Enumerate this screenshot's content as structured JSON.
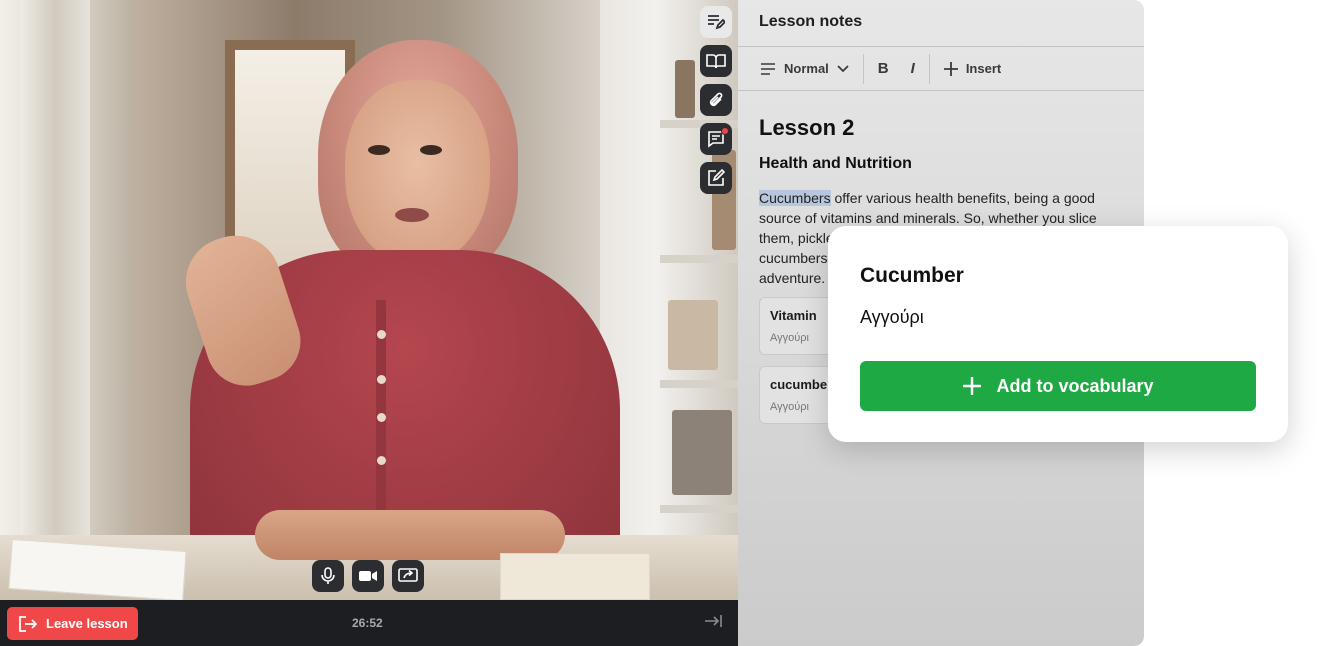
{
  "video": {
    "timer": "26:52",
    "leave_label": "Leave lesson"
  },
  "rail": {
    "icons": [
      "notes-icon",
      "book-icon",
      "paperclip-icon",
      "chat-icon",
      "edit-icon"
    ]
  },
  "notes": {
    "title": "Lesson notes",
    "toolbar": {
      "style_label": "Normal",
      "bold_label": "B",
      "italic_label": "I",
      "insert_label": "Insert"
    },
    "heading": "Lesson 2",
    "subheading": "Health and Nutrition",
    "highlighted_word": "Cucumbers",
    "paragraph_lines": [
      " offer various health benefits, being a good",
      "source of vitamins and minerals. So, whether you slice",
      "them, pickle",
      "cucumbers",
      "adventure."
    ],
    "vocab_cards": [
      {
        "word": "Vitamin",
        "translation": "Αγγούρι"
      },
      {
        "word": "cucumber",
        "translation": "Αγγούρι"
      }
    ]
  },
  "popup": {
    "word": "Cucumber",
    "translation": "Αγγούρι",
    "add_label": "Add to vocabulary"
  },
  "colors": {
    "accent_green": "#1ea944",
    "leave_red": "#f04848",
    "dark_ui": "#1d1e21",
    "highlight": "#b7c6dc"
  }
}
